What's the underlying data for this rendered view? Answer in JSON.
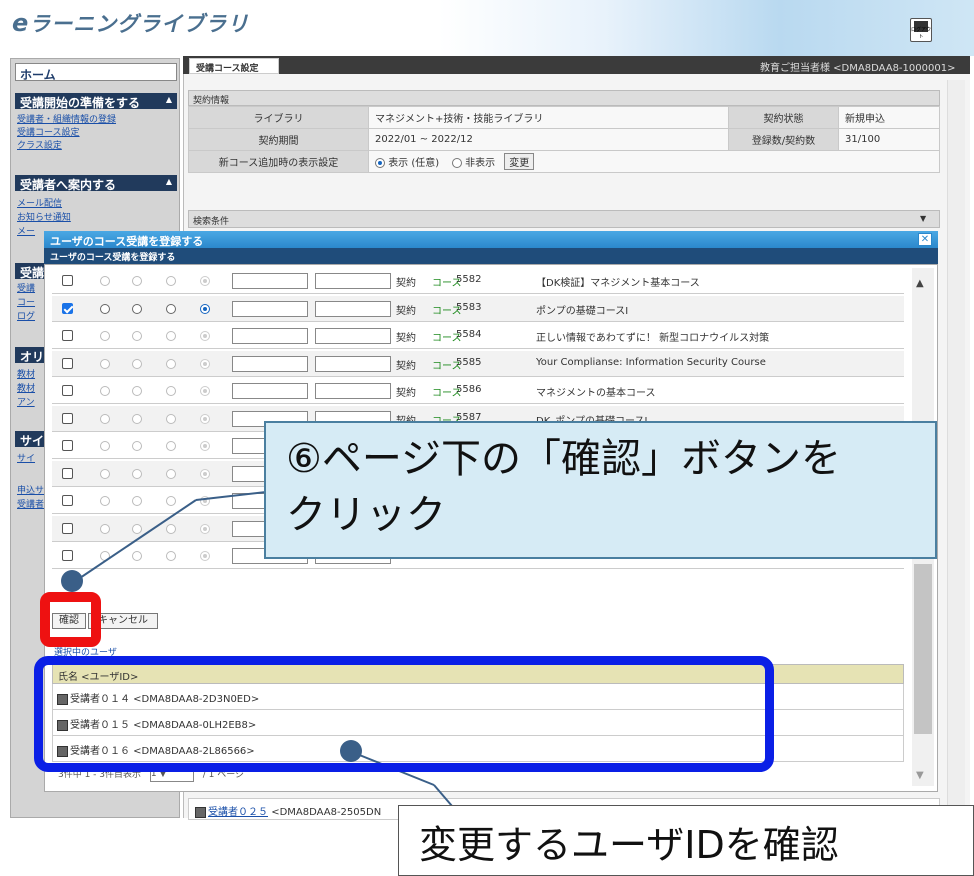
{
  "header": {
    "logo_e": "e",
    "logo_text": "ラーニングライブラリ",
    "logout_label": "ログアウト"
  },
  "nav": {
    "home": "ホーム",
    "sections": [
      {
        "title": "受講開始の準備をする",
        "items": [
          "受講者・組織情報の登録",
          "受講コース設定",
          "クラス設定"
        ]
      },
      {
        "title": "受講者へ案内する",
        "items": [
          "メール配信",
          "お知らせ通知",
          "メー"
        ]
      },
      {
        "title": "受講",
        "items": [
          "受講",
          "コー",
          "ログ"
        ]
      },
      {
        "title": "オリ",
        "items": [
          "教材",
          "教材",
          "アン"
        ]
      },
      {
        "title": "サイ",
        "items": [
          "サイ"
        ]
      }
    ],
    "extra": [
      "申込サ",
      "受講者"
    ]
  },
  "main": {
    "tab": "受講コース設定",
    "user_info": "教育ご担当者様 <DMA8DAA8-1000001>",
    "contract_header": "契約情報",
    "contract": {
      "library_label": "ライブラリ",
      "library_value": "マネジメント+技術・技能ライブラリ",
      "status_label": "契約状態",
      "status_value": "新規申込",
      "period_label": "契約期間",
      "period_value": "2022/01 ~ 2022/12",
      "count_label": "登録数/契約数",
      "count_value": "31/100",
      "display_label": "新コース追加時の表示設定",
      "show_label": "表示 (任意)",
      "hide_label": "非表示",
      "change_btn": "変更"
    },
    "search_header": "検索条件",
    "below_row_user": "受講者０２５",
    "below_row_id": "<DMA8DAA8-2505DN"
  },
  "dialog": {
    "title": "ユーザのコース受講を登録する",
    "subtitle": "ユーザのコース受講を登録する",
    "courses": [
      {
        "contract": "契約",
        "type": "コース",
        "id": "5582",
        "name": "【DK検証】マネジメント基本コース",
        "checked": false
      },
      {
        "contract": "契約",
        "type": "コース",
        "id": "5583",
        "name": "ポンプの基礎コースⅠ",
        "checked": true
      },
      {
        "contract": "契約",
        "type": "コース",
        "id": "5584",
        "name": "正しい情報であわてずに！ 新型コロナウイルス対策",
        "checked": false
      },
      {
        "contract": "契約",
        "type": "コース",
        "id": "5585",
        "name": "Your Complianse: Information Security Course",
        "checked": false
      },
      {
        "contract": "契約",
        "type": "コース",
        "id": "5586",
        "name": "マネジメントの基本コース",
        "checked": false
      },
      {
        "contract": "契約",
        "type": "コース",
        "id": "5587",
        "name": "DK_ポンプの基礎コースⅠ",
        "checked": false
      }
    ],
    "ok_btn": "確認",
    "cancel_btn": "キャンセル",
    "selected_label": "選択中のユーザ",
    "user_header": "氏名 <ユーザID>",
    "users": [
      "受講者０１４ <DMA8DAA8-2D3N0ED>",
      "受講者０１５ <DMA8DAA8-0LH2EB8>",
      "受講者０１６ <DMA8DAA8-2L86566>"
    ],
    "pager_left": "3件中 1 - 3件目表示",
    "pager_value": "1",
    "pager_right": "/ 1 ページ"
  },
  "annotations": {
    "callout1_line1": "⑥ページ下の「確認」ボタンを",
    "callout1_line2": "クリック",
    "callout2": "変更するユーザIDを確認",
    "red": "#ee1111",
    "blue": "#0a1fe6"
  }
}
